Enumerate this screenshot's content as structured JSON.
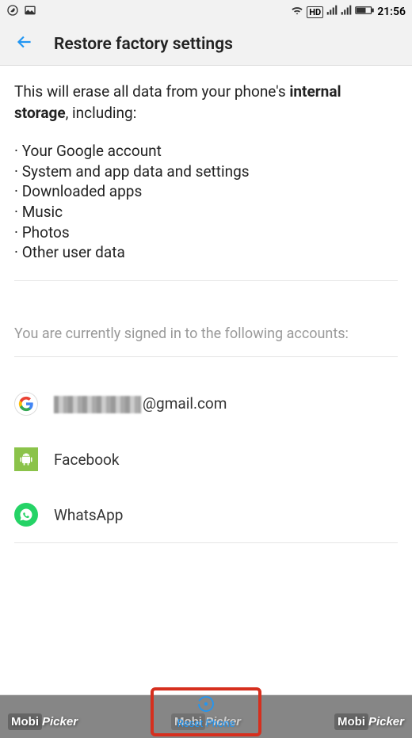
{
  "status": {
    "time": "21:56",
    "hd": "HD"
  },
  "header": {
    "title": "Restore factory settings"
  },
  "main": {
    "warning_prefix": "This will erase all data from your phone's ",
    "warning_bold": "internal storage",
    "warning_suffix": ", including:",
    "erase_items": [
      "Your Google account",
      "System and app data and settings",
      "Downloaded apps",
      "Music",
      "Photos",
      "Other user data"
    ],
    "signed_in_text": "You are currently signed in to the following accounts:",
    "accounts": [
      {
        "icon": "google",
        "label": "@gmail.com",
        "obscured": true
      },
      {
        "icon": "android",
        "label": "Facebook",
        "obscured": false
      },
      {
        "icon": "whatsapp",
        "label": "WhatsApp",
        "obscured": false
      }
    ]
  },
  "footer": {
    "reset_label": "Reset Phone"
  },
  "watermark": {
    "text": "MobiPicker"
  }
}
